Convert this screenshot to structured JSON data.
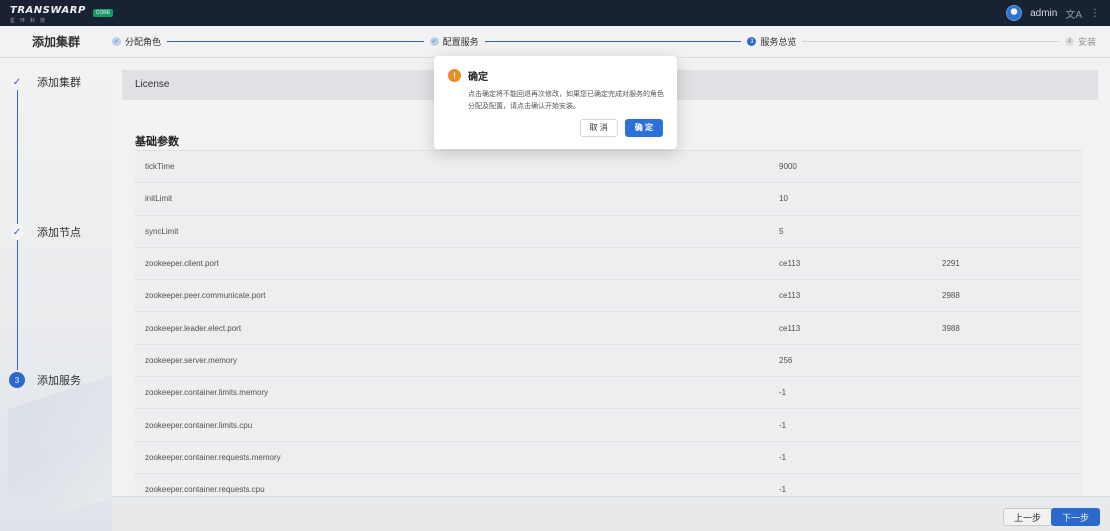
{
  "header": {
    "logo_text": "TRANSWARP",
    "logo_subtext": "星环科技",
    "logo_badge": "CORE",
    "username": "admin",
    "lang_icon": "translate-icon",
    "more_icon": "more-vertical-icon"
  },
  "stepbar": {
    "title": "添加集群",
    "steps": [
      {
        "label": "分配角色",
        "state": "done",
        "marker": "✓"
      },
      {
        "label": "配置服务",
        "state": "done",
        "marker": "✓"
      },
      {
        "label": "服务总览",
        "state": "current",
        "marker": "3"
      },
      {
        "label": "安装",
        "state": "wait",
        "marker": "4"
      }
    ]
  },
  "sidebar": {
    "items": [
      {
        "label": "添加集群",
        "marker": "✓"
      },
      {
        "label": "添加节点",
        "marker": "✓"
      },
      {
        "label": "添加服务",
        "marker": "3"
      }
    ]
  },
  "main": {
    "license_label": "License",
    "section_title": "基础参数",
    "rows": [
      [
        "tickTime",
        "9000",
        ""
      ],
      [
        "initLimit",
        "10",
        ""
      ],
      [
        "syncLimit",
        "5",
        ""
      ],
      [
        "zookeeper.client.port",
        "ce113",
        "2291"
      ],
      [
        "zookeeper.peer.communicate.port",
        "ce113",
        "2988"
      ],
      [
        "zookeeper.leader.elect.port",
        "ce113",
        "3988"
      ],
      [
        "zookeeper.server.memory",
        "256",
        ""
      ],
      [
        "zookeeper.container.limits.memory",
        "-1",
        ""
      ],
      [
        "zookeeper.container.limits.cpu",
        "-1",
        ""
      ],
      [
        "zookeeper.container.requests.memory",
        "-1",
        ""
      ],
      [
        "zookeeper.container.requests.cpu",
        "-1",
        ""
      ]
    ]
  },
  "footer": {
    "prev_label": "上一步",
    "next_label": "下一步"
  },
  "dialog": {
    "title": "确定",
    "message": "点击确定将不能回退再次修改，如果您已确定完成对服务的角色分配及配置，请点击确认开始安装。",
    "cancel_label": "取 消",
    "confirm_label": "确 定",
    "icon_glyph": "!",
    "accent": "#2f6fd8",
    "warning_color": "#f08a24"
  }
}
